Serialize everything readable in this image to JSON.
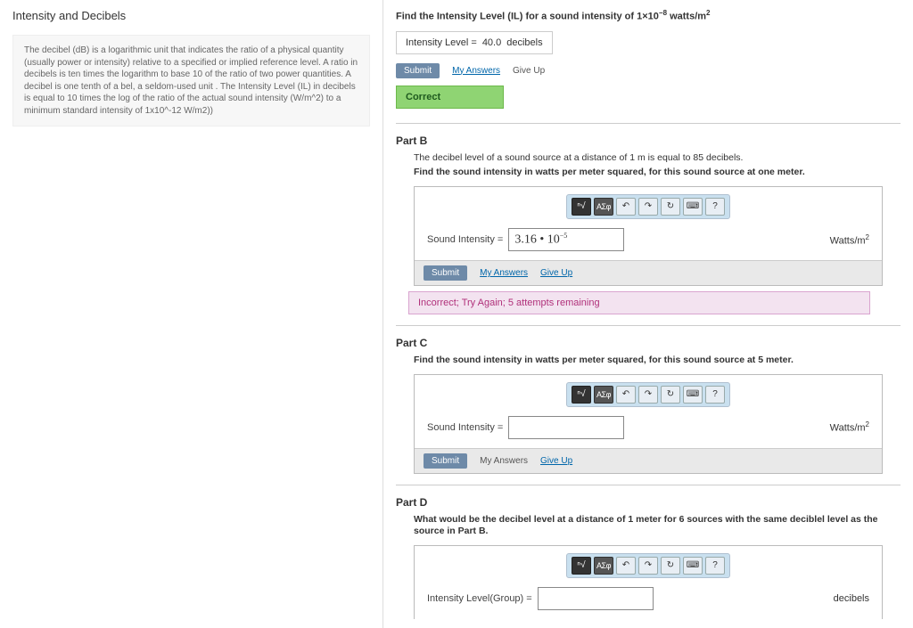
{
  "left": {
    "title": "Intensity and Decibels",
    "description": "The decibel (dB) is a logarithmic unit that indicates the ratio of a physical quantity (usually power or intensity) relative to a specified or implied reference level. A ratio in decibels is ten times the logarithm to base 10 of the ratio of two power quantities. A decibel is one tenth of a bel, a seldom-used unit . The Intensity Level (IL) in decibels is equal to 10 times the log of the ratio of the actual sound intensity (W/m^2) to a minimum standard intensity of 1x10^-12 W/m2))"
  },
  "partA": {
    "prompt_pre": "Find the Intensity Level (IL) for a sound intensity of 1×10",
    "prompt_exp": "−8",
    "prompt_post": " watts/m",
    "prompt_sq": "2",
    "il_label": "Intensity Level =",
    "il_value": "40.0",
    "il_units": "decibels",
    "submit": "Submit",
    "my_answers": "My Answers",
    "give_up": "Give Up",
    "correct": "Correct"
  },
  "partB": {
    "title": "Part B",
    "line1": "The decibel level of a sound source at a distance of 1 m is equal to 85 decibels.",
    "line2": "Find the sound intensity in watts per meter squared, for this sound source at one meter.",
    "answer_label": "Sound Intensity =",
    "answer_value_html": "3.16 • 10",
    "answer_exp": "−5",
    "units_pre": "Watts/m",
    "units_sq": "2",
    "submit": "Submit",
    "my_answers": "My Answers",
    "give_up": "Give Up",
    "incorrect": "Incorrect; Try Again; 5 attempts remaining"
  },
  "partC": {
    "title": "Part C",
    "line1": "Find the sound intensity in watts per meter squared, for this sound source at 5 meter.",
    "answer_label": "Sound Intensity =",
    "units_pre": "Watts/m",
    "units_sq": "2",
    "submit": "Submit",
    "my_answers": "My Answers",
    "give_up": "Give Up"
  },
  "partD": {
    "title": "Part D",
    "line1": "What would be the decibel level at a distance of 1 meter for 6 sources with the same deciblel level as the source in Part B.",
    "answer_label": "Intensity Level(Group) =",
    "units": "decibels"
  },
  "toolbar": {
    "root": "ⁿ√",
    "greek": "ΑΣφ",
    "undo": "↶",
    "redo": "↷",
    "reset": "↻",
    "keyboard": "⌨",
    "help": "?"
  }
}
